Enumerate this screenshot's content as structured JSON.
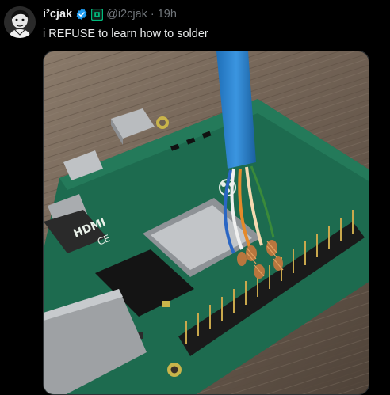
{
  "author": {
    "display_name": "i²cjak",
    "handle": "@i2cjak",
    "separator": "·",
    "timestamp": "19h",
    "verified": true,
    "avatar_icon": "avatar-portrait",
    "affiliation_icon": "affiliation-badge-icon"
  },
  "post": {
    "text": "i REFUSE to learn how to solder"
  },
  "media": {
    "icon": "raspberry-pi-photo"
  },
  "colors": {
    "background": "#000000",
    "text": "#e7e9ea",
    "secondary": "#71767b",
    "verified": "#1d9bf0",
    "affiliation": "#00ba7c"
  }
}
